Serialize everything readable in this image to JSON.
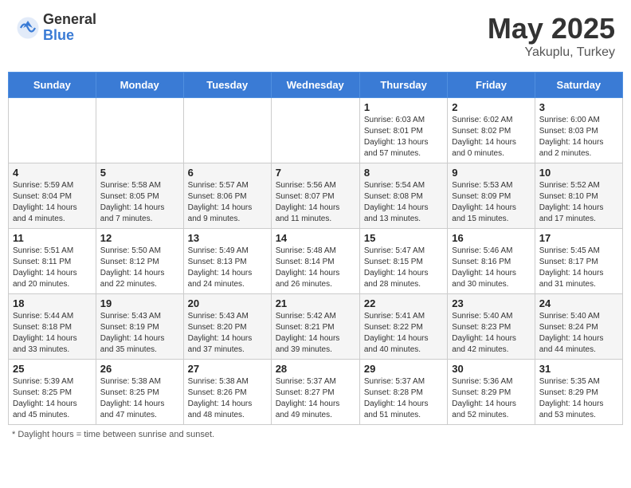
{
  "header": {
    "logo_general": "General",
    "logo_blue": "Blue",
    "title": "May 2025",
    "location": "Yakuplu, Turkey"
  },
  "footer": {
    "note": "Daylight hours"
  },
  "days_of_week": [
    "Sunday",
    "Monday",
    "Tuesday",
    "Wednesday",
    "Thursday",
    "Friday",
    "Saturday"
  ],
  "weeks": [
    [
      {
        "day": "",
        "info": ""
      },
      {
        "day": "",
        "info": ""
      },
      {
        "day": "",
        "info": ""
      },
      {
        "day": "",
        "info": ""
      },
      {
        "day": "1",
        "info": "Sunrise: 6:03 AM\nSunset: 8:01 PM\nDaylight: 13 hours\nand 57 minutes."
      },
      {
        "day": "2",
        "info": "Sunrise: 6:02 AM\nSunset: 8:02 PM\nDaylight: 14 hours\nand 0 minutes."
      },
      {
        "day": "3",
        "info": "Sunrise: 6:00 AM\nSunset: 8:03 PM\nDaylight: 14 hours\nand 2 minutes."
      }
    ],
    [
      {
        "day": "4",
        "info": "Sunrise: 5:59 AM\nSunset: 8:04 PM\nDaylight: 14 hours\nand 4 minutes."
      },
      {
        "day": "5",
        "info": "Sunrise: 5:58 AM\nSunset: 8:05 PM\nDaylight: 14 hours\nand 7 minutes."
      },
      {
        "day": "6",
        "info": "Sunrise: 5:57 AM\nSunset: 8:06 PM\nDaylight: 14 hours\nand 9 minutes."
      },
      {
        "day": "7",
        "info": "Sunrise: 5:56 AM\nSunset: 8:07 PM\nDaylight: 14 hours\nand 11 minutes."
      },
      {
        "day": "8",
        "info": "Sunrise: 5:54 AM\nSunset: 8:08 PM\nDaylight: 14 hours\nand 13 minutes."
      },
      {
        "day": "9",
        "info": "Sunrise: 5:53 AM\nSunset: 8:09 PM\nDaylight: 14 hours\nand 15 minutes."
      },
      {
        "day": "10",
        "info": "Sunrise: 5:52 AM\nSunset: 8:10 PM\nDaylight: 14 hours\nand 17 minutes."
      }
    ],
    [
      {
        "day": "11",
        "info": "Sunrise: 5:51 AM\nSunset: 8:11 PM\nDaylight: 14 hours\nand 20 minutes."
      },
      {
        "day": "12",
        "info": "Sunrise: 5:50 AM\nSunset: 8:12 PM\nDaylight: 14 hours\nand 22 minutes."
      },
      {
        "day": "13",
        "info": "Sunrise: 5:49 AM\nSunset: 8:13 PM\nDaylight: 14 hours\nand 24 minutes."
      },
      {
        "day": "14",
        "info": "Sunrise: 5:48 AM\nSunset: 8:14 PM\nDaylight: 14 hours\nand 26 minutes."
      },
      {
        "day": "15",
        "info": "Sunrise: 5:47 AM\nSunset: 8:15 PM\nDaylight: 14 hours\nand 28 minutes."
      },
      {
        "day": "16",
        "info": "Sunrise: 5:46 AM\nSunset: 8:16 PM\nDaylight: 14 hours\nand 30 minutes."
      },
      {
        "day": "17",
        "info": "Sunrise: 5:45 AM\nSunset: 8:17 PM\nDaylight: 14 hours\nand 31 minutes."
      }
    ],
    [
      {
        "day": "18",
        "info": "Sunrise: 5:44 AM\nSunset: 8:18 PM\nDaylight: 14 hours\nand 33 minutes."
      },
      {
        "day": "19",
        "info": "Sunrise: 5:43 AM\nSunset: 8:19 PM\nDaylight: 14 hours\nand 35 minutes."
      },
      {
        "day": "20",
        "info": "Sunrise: 5:43 AM\nSunset: 8:20 PM\nDaylight: 14 hours\nand 37 minutes."
      },
      {
        "day": "21",
        "info": "Sunrise: 5:42 AM\nSunset: 8:21 PM\nDaylight: 14 hours\nand 39 minutes."
      },
      {
        "day": "22",
        "info": "Sunrise: 5:41 AM\nSunset: 8:22 PM\nDaylight: 14 hours\nand 40 minutes."
      },
      {
        "day": "23",
        "info": "Sunrise: 5:40 AM\nSunset: 8:23 PM\nDaylight: 14 hours\nand 42 minutes."
      },
      {
        "day": "24",
        "info": "Sunrise: 5:40 AM\nSunset: 8:24 PM\nDaylight: 14 hours\nand 44 minutes."
      }
    ],
    [
      {
        "day": "25",
        "info": "Sunrise: 5:39 AM\nSunset: 8:25 PM\nDaylight: 14 hours\nand 45 minutes."
      },
      {
        "day": "26",
        "info": "Sunrise: 5:38 AM\nSunset: 8:25 PM\nDaylight: 14 hours\nand 47 minutes."
      },
      {
        "day": "27",
        "info": "Sunrise: 5:38 AM\nSunset: 8:26 PM\nDaylight: 14 hours\nand 48 minutes."
      },
      {
        "day": "28",
        "info": "Sunrise: 5:37 AM\nSunset: 8:27 PM\nDaylight: 14 hours\nand 49 minutes."
      },
      {
        "day": "29",
        "info": "Sunrise: 5:37 AM\nSunset: 8:28 PM\nDaylight: 14 hours\nand 51 minutes."
      },
      {
        "day": "30",
        "info": "Sunrise: 5:36 AM\nSunset: 8:29 PM\nDaylight: 14 hours\nand 52 minutes."
      },
      {
        "day": "31",
        "info": "Sunrise: 5:35 AM\nSunset: 8:29 PM\nDaylight: 14 hours\nand 53 minutes."
      }
    ]
  ]
}
